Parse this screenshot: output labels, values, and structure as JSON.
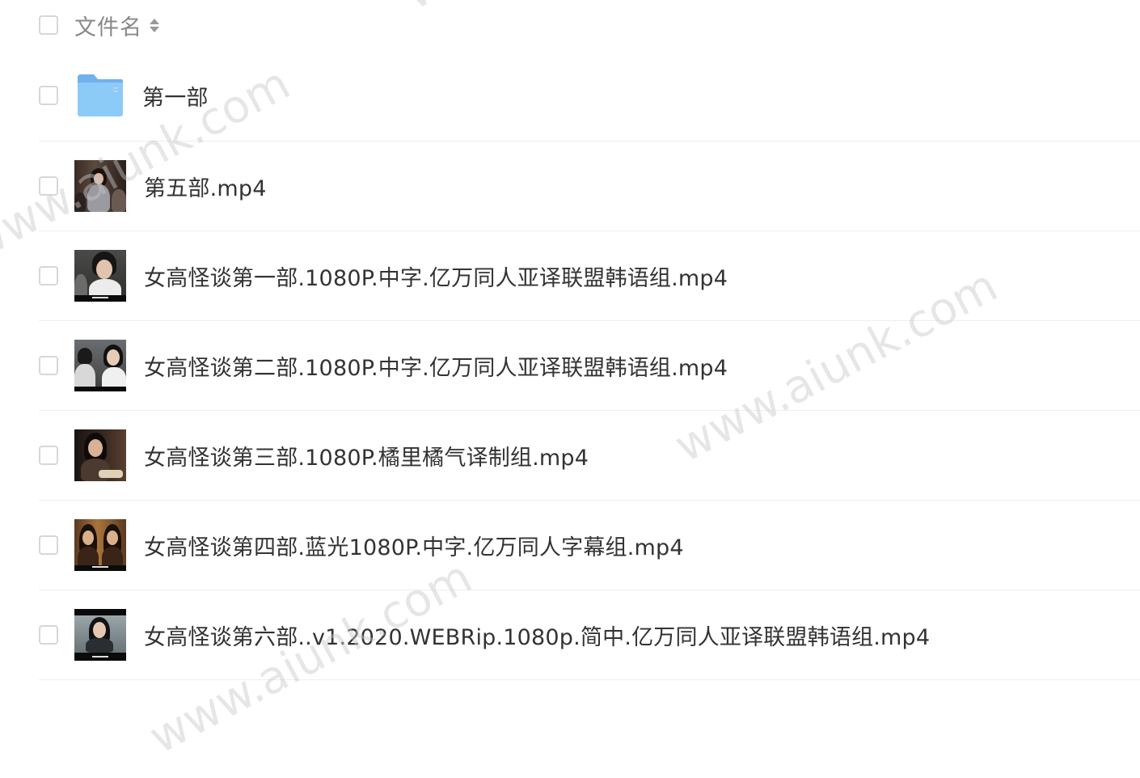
{
  "header": {
    "column_label": "文件名",
    "sort_icon": "sort-updown-icon"
  },
  "files": [
    {
      "name": "第一部",
      "type": "folder",
      "icon": "folder-icon"
    },
    {
      "name": "第五部.mp4",
      "type": "video",
      "icon": "video-thumbnail"
    },
    {
      "name": "女高怪谈第一部.1080P.中字.亿万同人亚译联盟韩语组.mp4",
      "type": "video",
      "icon": "video-thumbnail"
    },
    {
      "name": "女高怪谈第二部.1080P.中字.亿万同人亚译联盟韩语组.mp4",
      "type": "video",
      "icon": "video-thumbnail"
    },
    {
      "name": "女高怪谈第三部.1080P.橘里橘气译制组.mp4",
      "type": "video",
      "icon": "video-thumbnail"
    },
    {
      "name": "女高怪谈第四部.蓝光1080P.中字.亿万同人字幕组.mp4",
      "type": "video",
      "icon": "video-thumbnail"
    },
    {
      "name": "女高怪谈第六部..v1.2020.WEBRip.1080p.简中.亿万同人亚译联盟韩语组.mp4",
      "type": "video",
      "icon": "video-thumbnail"
    }
  ],
  "watermarks": [
    "www.aiunk.com",
    "www.aiunk.com",
    "www.aiunk.com",
    "www.aiunk.com"
  ],
  "colors": {
    "folder": "#7cbcf2",
    "checkbox_border": "#d7d7d7",
    "divider": "#eeeeee",
    "text": "#333333",
    "header_text": "#888888"
  }
}
